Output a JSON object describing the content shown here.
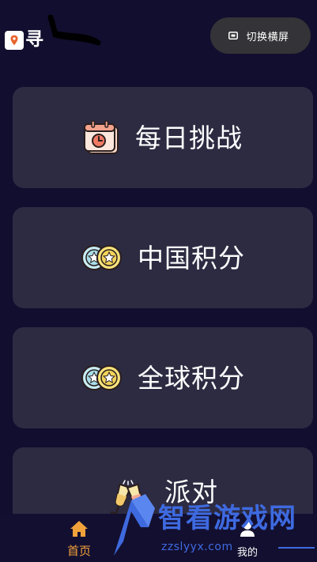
{
  "header": {
    "logo_text": "寻",
    "orientation_button": {
      "label": "切换横屏",
      "icon": "screen-rotate-icon"
    }
  },
  "cards": [
    {
      "id": "daily",
      "label": "每日挑战",
      "icon": "calendar-icon"
    },
    {
      "id": "china",
      "label": "中国积分",
      "icon": "coins-icon"
    },
    {
      "id": "global",
      "label": "全球积分",
      "icon": "coins-icon"
    },
    {
      "id": "party",
      "label": "派对",
      "icon": "champagne-toast-icon"
    }
  ],
  "bottom_nav": {
    "home_label": "首页",
    "mine_label": "我的",
    "active": "home"
  },
  "watermark": {
    "title": "智看游戏网",
    "url": "zzslyyx.com"
  },
  "colors": {
    "background": "#120e2f",
    "card": "#2d2b42",
    "active_nav": "#f2a23a",
    "watermark": "#3e6ae0"
  }
}
